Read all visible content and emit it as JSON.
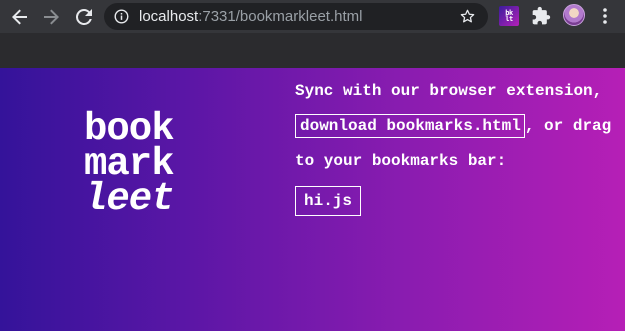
{
  "browser": {
    "url_host": "localhost",
    "url_rest": ":7331/bookmarkleet.html",
    "extension_label_line1": "bk",
    "extension_label_line2": "lt"
  },
  "logo": {
    "line1": "book",
    "line2": "mark",
    "line3": "leet"
  },
  "main": {
    "sync_text": "Sync with our browser extension,",
    "download_link": "download bookmarks.html",
    "or_drag_text": ", or drag",
    "to_bar_text": "to your bookmarks bar:",
    "bookmarklet_label": "hi.js"
  },
  "colors": {
    "gradient_start": "#34139a",
    "gradient_end": "#b61fb6",
    "chrome_toolbar": "#35363a",
    "omnibox": "#202124"
  },
  "icons": [
    "back-arrow-icon",
    "forward-arrow-icon",
    "reload-icon",
    "info-icon",
    "star-icon",
    "puzzle-icon",
    "menu-dots-icon"
  ]
}
